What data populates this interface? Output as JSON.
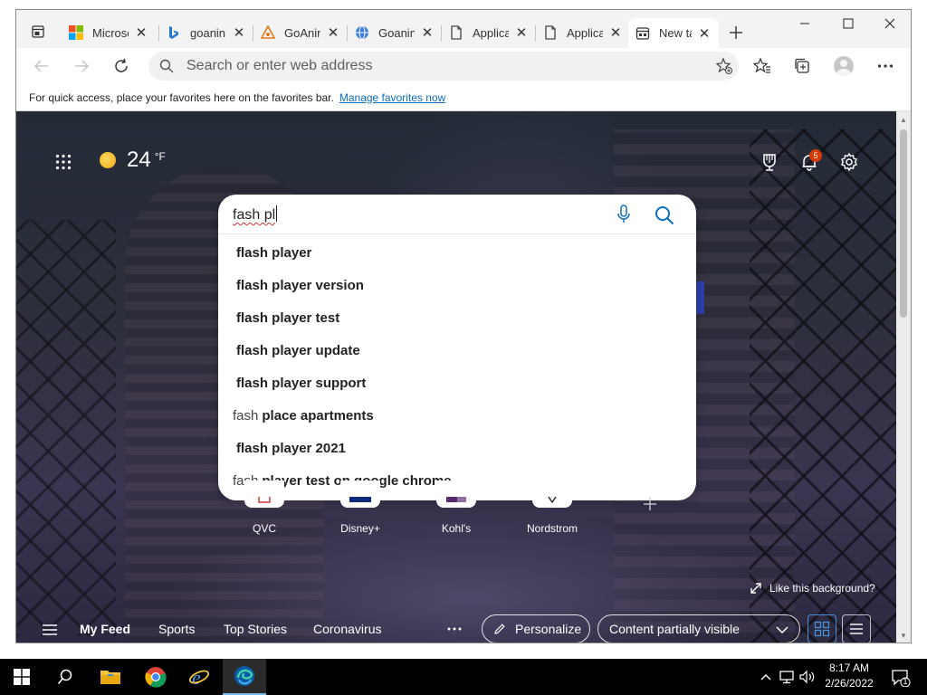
{
  "browser": {
    "tabs": [
      {
        "label": "Microso",
        "icon": "microsoft-logo-icon",
        "active": false
      },
      {
        "label": "goanin",
        "icon": "bing-logo-icon",
        "active": false
      },
      {
        "label": "GoAnin",
        "icon": "goanimate-icon",
        "active": false
      },
      {
        "label": "Goanin",
        "icon": "globe-icon",
        "active": false
      },
      {
        "label": "Applica",
        "icon": "document-icon",
        "active": false
      },
      {
        "label": "Applica",
        "icon": "document-icon",
        "active": false
      },
      {
        "label": "New ta",
        "icon": "new-tab-icon",
        "active": true
      }
    ],
    "address": {
      "placeholder": "Search or enter web address",
      "value": ""
    },
    "favorites_bar": {
      "message": "For quick access, place your favorites here on the favorites bar.",
      "link": "Manage favorites now"
    }
  },
  "newtab": {
    "weather": {
      "temp": "24",
      "unit": "°F",
      "icon": "sun-icon"
    },
    "notifications_count": "5",
    "search": {
      "query": "fash pl",
      "suggestions": [
        {
          "prefix": "",
          "bold": "flash player"
        },
        {
          "prefix": "",
          "bold": "flash player version"
        },
        {
          "prefix": "",
          "bold": "flash player test"
        },
        {
          "prefix": "",
          "bold": "flash player update"
        },
        {
          "prefix": "",
          "bold": "flash player support"
        },
        {
          "prefix": "fash",
          "bold": "place apartments"
        },
        {
          "prefix": "",
          "bold": "flash player 2021"
        },
        {
          "prefix": "fash",
          "bold": "player test on google chrome"
        }
      ]
    },
    "quick_links": [
      {
        "label": "QVC"
      },
      {
        "label": "Disney+"
      },
      {
        "label": "Kohl's"
      },
      {
        "label": "Nordstrom"
      }
    ],
    "like_background": "Like this background?",
    "feed": {
      "tabs": [
        "My Feed",
        "Sports",
        "Top Stories",
        "Coronavirus"
      ],
      "personalize": "Personalize",
      "content_visibility": "Content partially visible"
    }
  },
  "taskbar": {
    "time": "8:17 AM",
    "date": "2/26/2022",
    "apps": [
      "file-explorer-icon",
      "chrome-icon",
      "internet-explorer-icon",
      "edge-icon"
    ],
    "notification_count": "1"
  },
  "colors": {
    "accent": "#0f6cbd",
    "badge": "#d83b01",
    "edge_blue": "#0c59a4"
  }
}
